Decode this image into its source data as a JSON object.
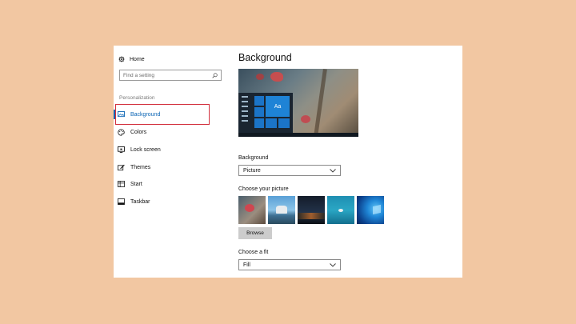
{
  "sidebar": {
    "home_label": "Home",
    "search_placeholder": "Find a setting",
    "section_label": "Personalization",
    "items": [
      {
        "label": "Background",
        "icon": "picture-icon",
        "active": true
      },
      {
        "label": "Colors",
        "icon": "palette-icon"
      },
      {
        "label": "Lock screen",
        "icon": "lock-screen-icon"
      },
      {
        "label": "Themes",
        "icon": "themes-brush-icon"
      },
      {
        "label": "Start",
        "icon": "start-grid-icon"
      },
      {
        "label": "Taskbar",
        "icon": "taskbar-icon"
      }
    ]
  },
  "main": {
    "title": "Background",
    "preview_tile_text": "Aa",
    "background_label": "Background",
    "background_value": "Picture",
    "choose_picture_label": "Choose your picture",
    "browse_label": "Browse",
    "fit_label": "Choose a fit",
    "fit_value": "Fill"
  },
  "colors": {
    "accent": "#0a64b4",
    "highlight": "#d2303d",
    "page_background": "#f2c7a2"
  }
}
